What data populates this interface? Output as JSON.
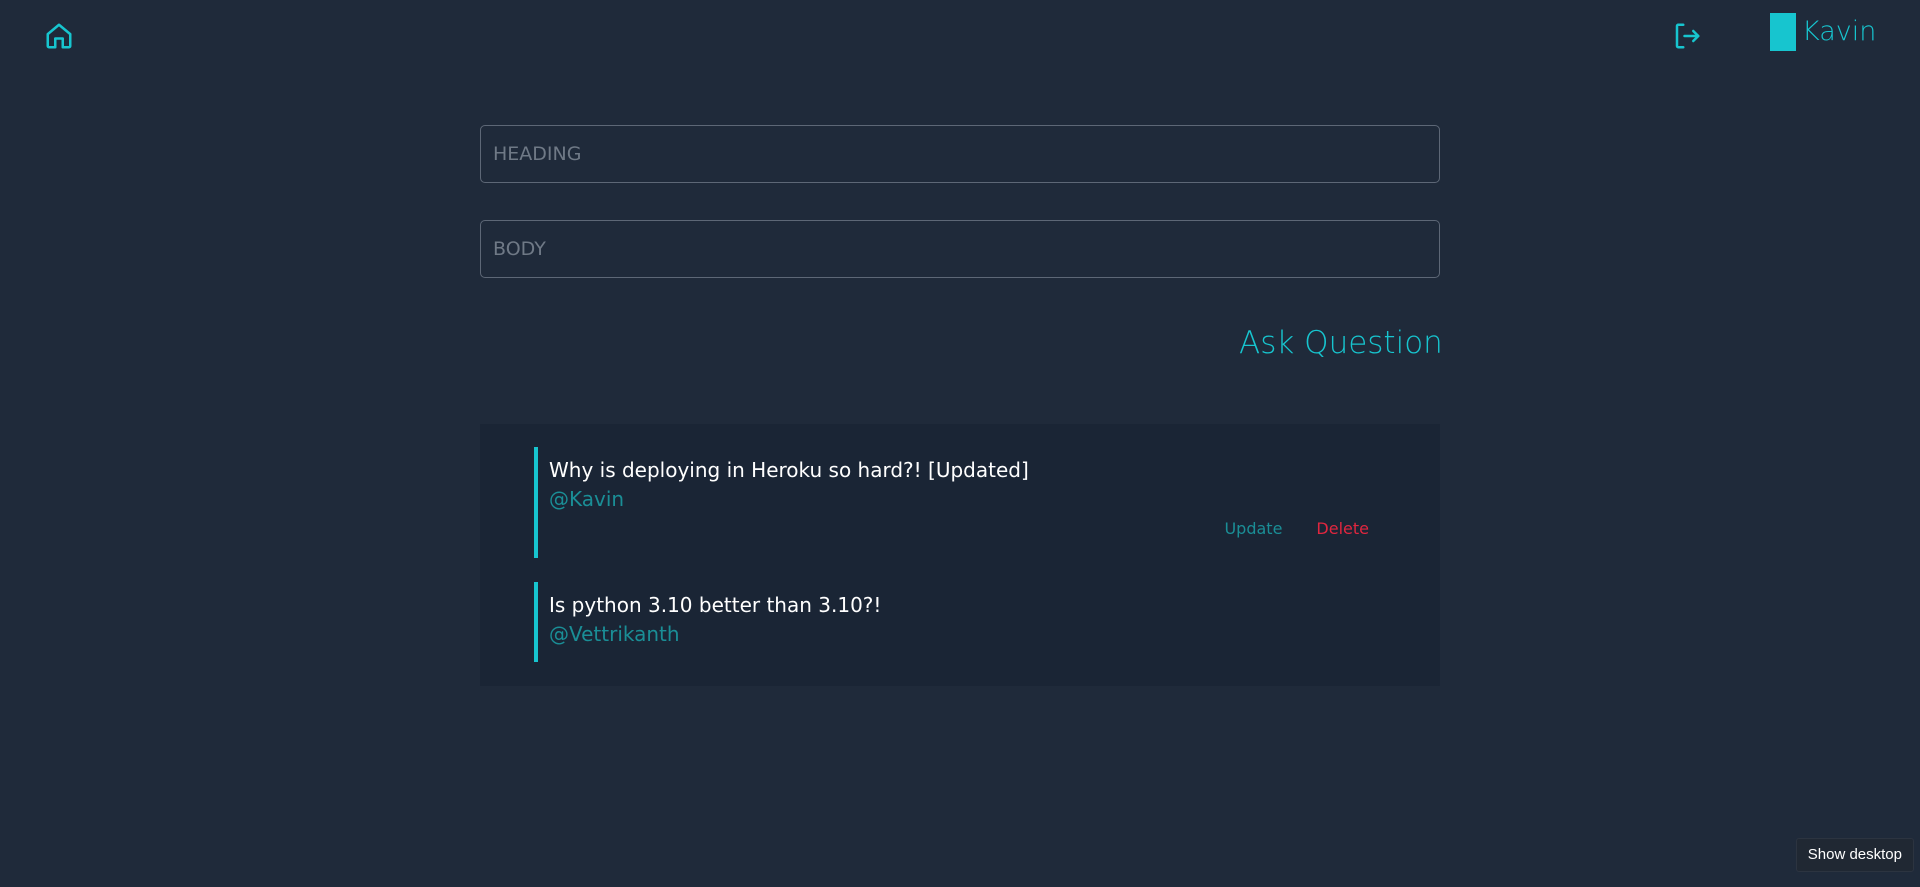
{
  "nav": {
    "home_icon": "home-icon",
    "logout_icon": "logout-icon",
    "user": {
      "name": "Kavin"
    }
  },
  "form": {
    "heading_placeholder": "HEADING",
    "heading_value": "",
    "body_placeholder": "BODY",
    "body_value": "",
    "ask_label": "Ask Question"
  },
  "questions": [
    {
      "title": "Why is deploying in Heroku so hard?! [Updated]",
      "author": "@Kavin",
      "update_label": "Update",
      "delete_label": "Delete"
    },
    {
      "title": "Is python 3.10 better than 3.10?!",
      "author": "@Vettrikanth"
    }
  ],
  "taskbar": {
    "tooltip": "Show desktop"
  },
  "colors": {
    "background": "#1f2a3a",
    "panel": "#1a2535",
    "accent": "#17c5cf",
    "author": "#1a8e96",
    "danger": "#e0263f"
  }
}
